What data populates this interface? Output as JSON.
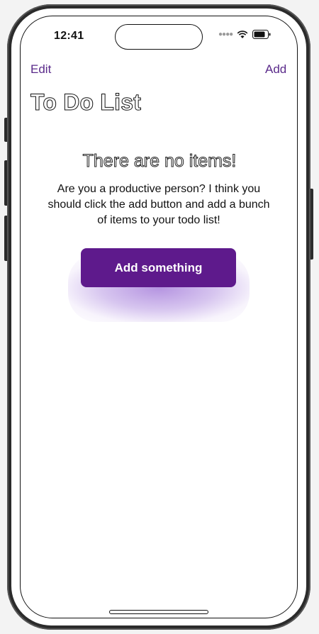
{
  "status_bar": {
    "time": "12:41",
    "signal_icon": "signal-dots-icon",
    "wifi_icon": "wifi-icon",
    "battery_icon": "battery-icon"
  },
  "nav": {
    "edit_label": "Edit",
    "add_label": "Add"
  },
  "page": {
    "title": "To Do List"
  },
  "empty_state": {
    "heading": "There are no items!",
    "body": "Are you a productive person? I think you should click the add button and add a bunch of items to your todo list!",
    "button_label": "Add something"
  },
  "colors": {
    "accent": "#5e1a8c",
    "nav_link": "#5a2a8a"
  }
}
